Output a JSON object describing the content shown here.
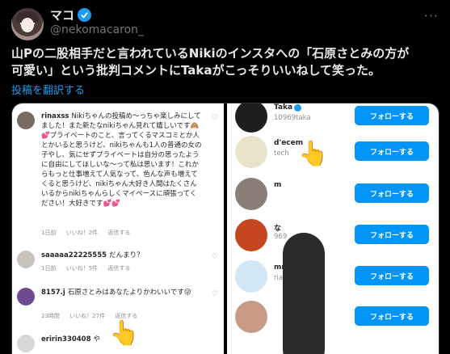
{
  "header": {
    "display_name": "マコ",
    "handle": "@nekomacaron_",
    "more_label": "···"
  },
  "tweet": {
    "text_line1": "山Pの二股相手だと言われているNikiのインスタへの「石原さとみの方が",
    "text_line2": "可愛い」という批判コメントにTakaがこっそりいいねして笑った。",
    "translate_label": "投稿を翻訳する"
  },
  "media": {
    "comments": [
      {
        "user": "rinaxss",
        "text": "Nikiちゃんの投稿め〜っちゃ楽しみにしてました！また新たなnikiちゃん見れて嬉しいです🙈💕プライベートのこと、言ってくるマスコミとか人とかいると思うけど、nikiちゃんも1人の普通の女の子やし、気にせずプライベートは自分の思ったように自由にしてほしいな〜って私は思います！これからもっと仕事増えて人気なって、色んな声も増えてくると思うけど、nikiちゃん大好き人間はたくさんいるからnikiちゃんらしくマイペースに頑張ってください！大好きです💕💕",
        "meta_time": "1日前",
        "meta_likes": "いいね！2件",
        "meta_reply": "返信する"
      },
      {
        "user": "saaaaa22225555",
        "text": "だんまり？",
        "meta_time": "1日前",
        "meta_likes": "いいね！5件",
        "meta_reply": "返信する"
      },
      {
        "user": "8157.j",
        "text": "石原さとみはあなたよりかわいいです😜",
        "meta_time": "23時間",
        "meta_likes": "いいね！27件",
        "meta_reply": "返信する"
      },
      {
        "user": "eririn330408",
        "text": "や",
        "meta_time": "",
        "meta_likes": "",
        "meta_reply": ""
      }
    ],
    "follow_list": [
      {
        "name": "Taka",
        "sub": "10969taka",
        "button": "フォローする"
      },
      {
        "name": "d'ecem",
        "sub": "tech",
        "button": "フォローする"
      },
      {
        "name": "m",
        "sub": "",
        "button": "フォローする"
      },
      {
        "name": "な",
        "sub": "969",
        "button": "フォローする"
      },
      {
        "name": "mma Yosi",
        "sub": "ria",
        "button": "フォローする"
      },
      {
        "name": "",
        "sub": "",
        "button": "フォローする"
      }
    ]
  },
  "colors": {
    "background": "#000000",
    "text": "#e7e9ea",
    "muted": "#71767b",
    "link": "#1d9bf0",
    "follow_button": "#0095f6"
  }
}
